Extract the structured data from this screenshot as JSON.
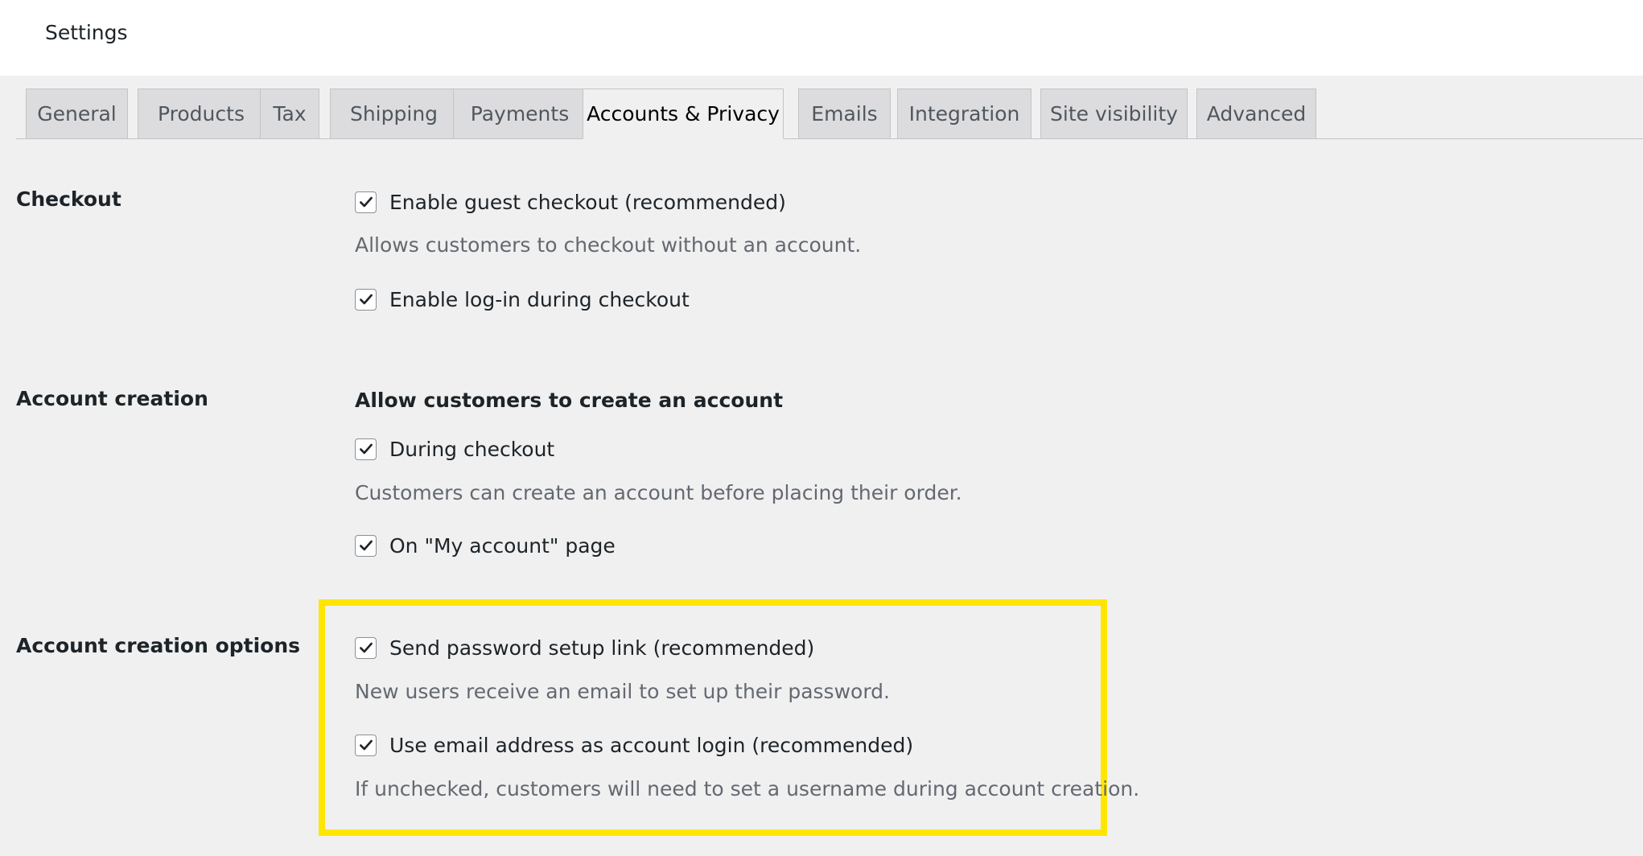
{
  "header": {
    "title": "Settings"
  },
  "tabs": [
    {
      "label": "General"
    },
    {
      "label": "Products"
    },
    {
      "label": "Tax"
    },
    {
      "label": "Shipping"
    },
    {
      "label": "Payments"
    },
    {
      "label": "Accounts & Privacy",
      "active": true
    },
    {
      "label": "Emails"
    },
    {
      "label": "Integration"
    },
    {
      "label": "Site visibility"
    },
    {
      "label": "Advanced"
    }
  ],
  "sections": {
    "checkout": {
      "label": "Checkout",
      "guest_checkout": {
        "label": "Enable guest checkout (recommended)",
        "checked": true
      },
      "guest_checkout_desc": "Allows customers to checkout without an account.",
      "login_checkout": {
        "label": "Enable log-in during checkout",
        "checked": true
      }
    },
    "account_creation": {
      "label": "Account creation",
      "heading": "Allow customers to create an account",
      "during_checkout": {
        "label": "During checkout",
        "checked": true
      },
      "during_checkout_desc": "Customers can create an account before placing their order.",
      "my_account": {
        "label": "On \"My account\" page",
        "checked": true
      }
    },
    "account_creation_options": {
      "label": "Account creation options",
      "password_link": {
        "label": "Send password setup link (recommended)",
        "checked": true
      },
      "password_link_desc": "New users receive an email to set up their password.",
      "email_login": {
        "label": "Use email address as account login (recommended)",
        "checked": true
      },
      "email_login_desc": "If unchecked, customers will need to set a username during account creation."
    }
  },
  "colors": {
    "highlight": "#ffe600",
    "background": "#f0f0f1",
    "tab_inactive": "#dcdcde"
  },
  "icons": {
    "checkbox_checked": "checkmark-icon"
  }
}
